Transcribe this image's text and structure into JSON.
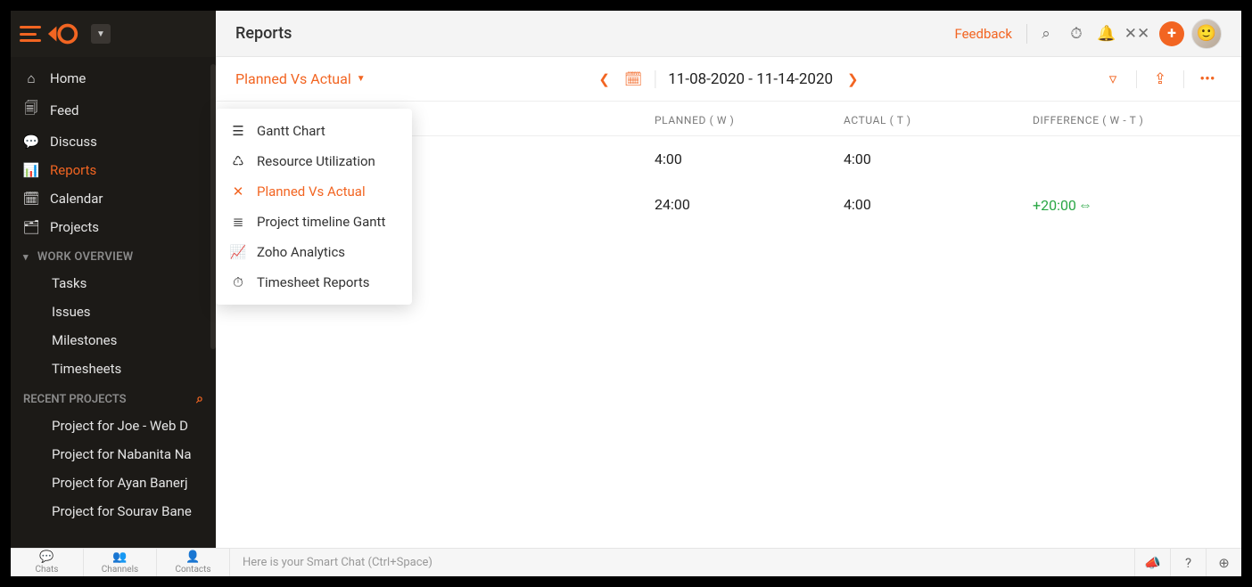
{
  "header": {
    "title": "Reports",
    "feedback": "Feedback"
  },
  "sidebar": {
    "nav": [
      {
        "label": "Home",
        "icon": "⌂"
      },
      {
        "label": "Feed",
        "icon": "🗐"
      },
      {
        "label": "Discuss",
        "icon": "💬"
      },
      {
        "label": "Reports",
        "icon": "📊"
      },
      {
        "label": "Calendar",
        "icon": "🗓"
      },
      {
        "label": "Projects",
        "icon": "🗂"
      }
    ],
    "work_overview_label": "WORK OVERVIEW",
    "work_overview": [
      {
        "label": "Tasks"
      },
      {
        "label": "Issues"
      },
      {
        "label": "Milestones"
      },
      {
        "label": "Timesheets"
      }
    ],
    "recent_label": "RECENT PROJECTS",
    "recent": [
      {
        "label": "Project for Joe - Web D"
      },
      {
        "label": "Project for Nabanita Na"
      },
      {
        "label": "Project for Ayan Banerj"
      },
      {
        "label": "Project for Sourav Bane"
      }
    ]
  },
  "subhead": {
    "picker_label": "Planned Vs Actual",
    "date_range": "11-08-2020 - 11-14-2020",
    "dropdown": [
      {
        "label": "Gantt Chart"
      },
      {
        "label": "Resource Utilization"
      },
      {
        "label": "Planned Vs Actual"
      },
      {
        "label": "Project timeline Gantt"
      },
      {
        "label": "Zoho Analytics"
      },
      {
        "label": "Timesheet Reports"
      }
    ]
  },
  "table": {
    "headers": {
      "planned": "PLANNED ( W )",
      "actual": "ACTUAL ( T )",
      "diff": "DIFFERENCE ( W - T )"
    },
    "rows": [
      {
        "planned": "4:00",
        "actual": "4:00",
        "diff": ""
      },
      {
        "planned": "24:00",
        "actual": "4:00",
        "diff": "+20:00"
      }
    ]
  },
  "footer": {
    "tabs": [
      {
        "label": "Chats",
        "icon": "💬"
      },
      {
        "label": "Channels",
        "icon": "👥"
      },
      {
        "label": "Contacts",
        "icon": "👤"
      }
    ],
    "chat_placeholder": "Here is your Smart Chat (Ctrl+Space)"
  }
}
